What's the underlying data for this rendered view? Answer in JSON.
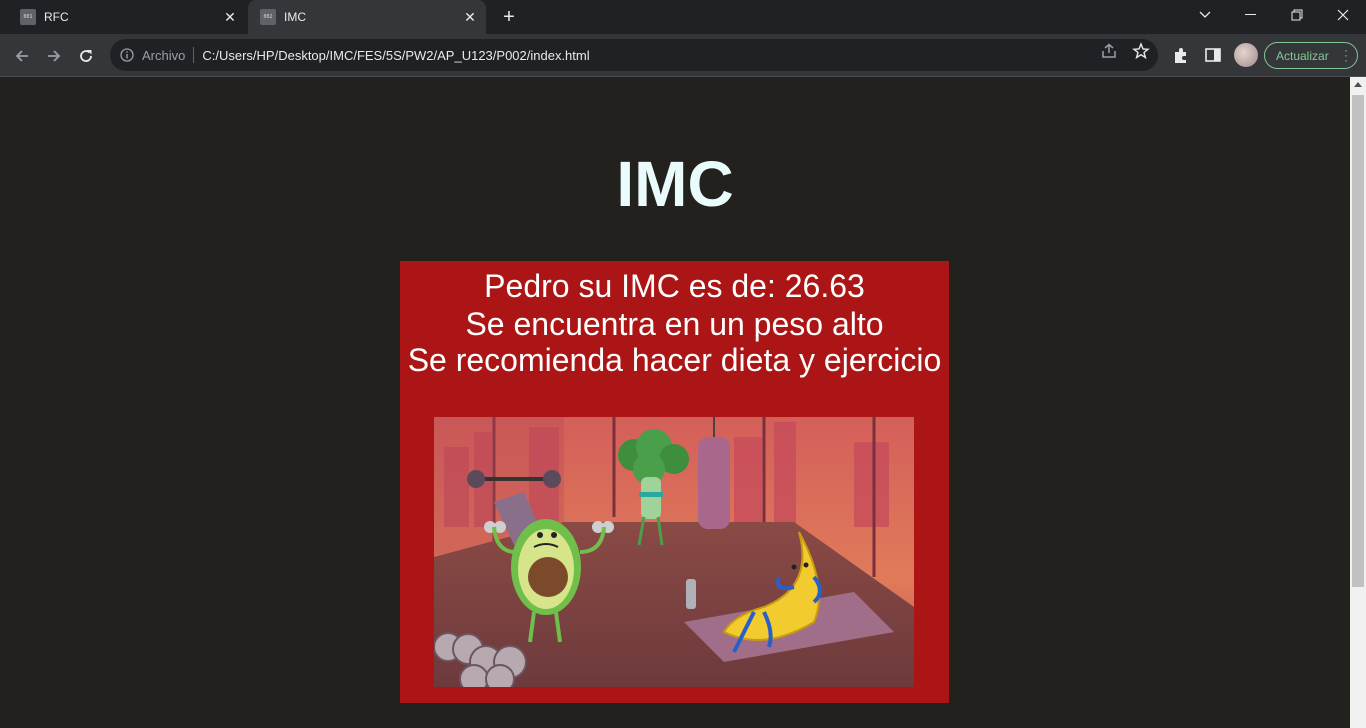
{
  "browser": {
    "tabs": [
      {
        "favicon": "001",
        "title": "RFC",
        "active": false
      },
      {
        "favicon": "002",
        "title": "IMC",
        "active": true
      }
    ],
    "address": {
      "scheme_label": "Archivo",
      "url": "C:/Users/HP/Desktop/IMC/FES/5S/PW2/AP_U123/P002/index.html"
    },
    "update_label": "Actualizar"
  },
  "page": {
    "title": "IMC",
    "result": {
      "line1": "Pedro su IMC es de: 26.63",
      "line2": "Se encuentra en un peso alto",
      "line3": "Se recomienda hacer dieta y ejercicio"
    }
  },
  "colors": {
    "background": "#22211d",
    "title": "#e9fbfb",
    "result_box": "#ab1515"
  },
  "icons": [
    "info-icon",
    "back-icon",
    "forward-icon",
    "reload-icon",
    "share-icon",
    "star-icon",
    "extensions-icon",
    "side-panel-icon",
    "more-icon",
    "close-icon",
    "chevron-down-icon",
    "minimize-icon",
    "restore-icon",
    "new-tab-icon"
  ]
}
